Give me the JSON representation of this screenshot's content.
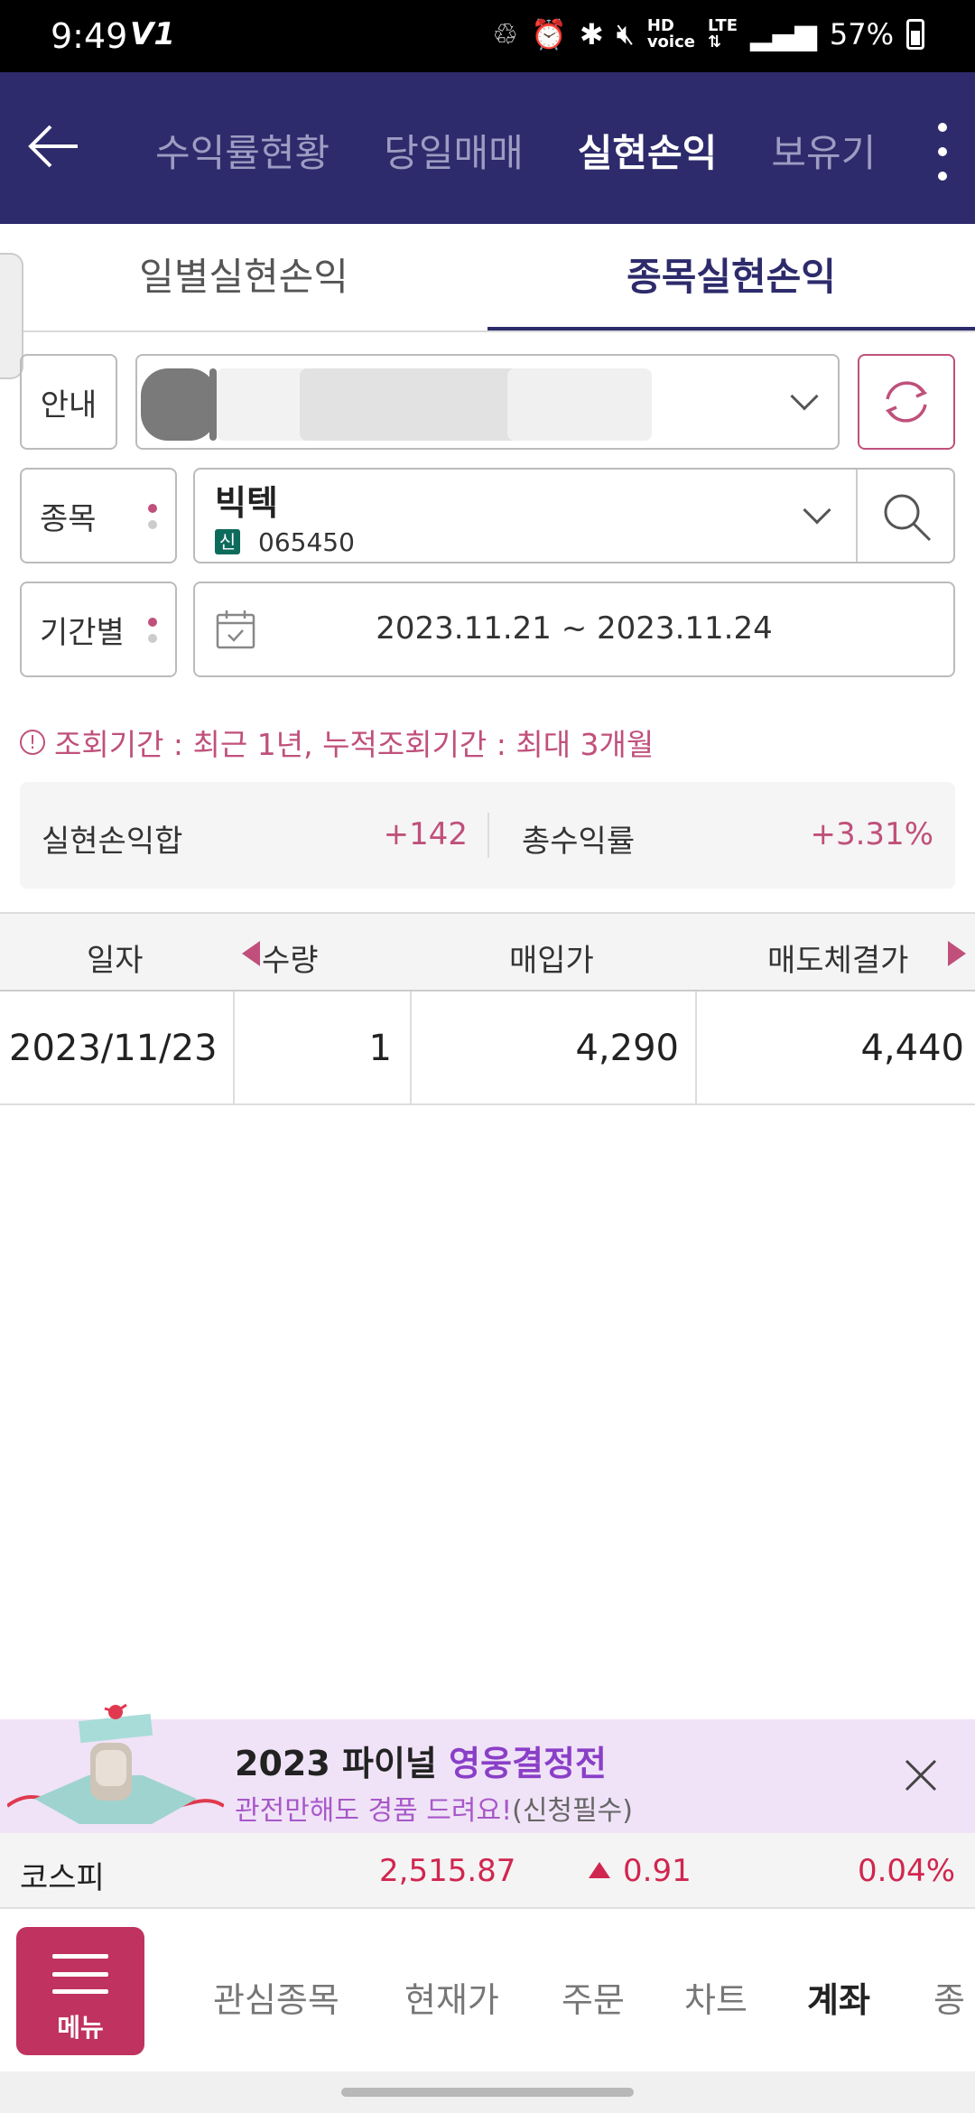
{
  "status_bar": {
    "time": "9:49",
    "carrier_icon": "V1",
    "battery": "57%",
    "icons": [
      "recycle-icon",
      "alarm-icon",
      "bluetooth-icon",
      "mute-icon",
      "hd-voice-icon",
      "lte-icon",
      "signal-icon",
      "battery-icon"
    ]
  },
  "top_nav": {
    "tabs": [
      {
        "label": "수익률현황",
        "active": false
      },
      {
        "label": "당일매매",
        "active": false
      },
      {
        "label": "실현손익",
        "active": true
      },
      {
        "label": "보유기",
        "active": false
      }
    ]
  },
  "sub_tabs": [
    {
      "label": "일별실현손익",
      "active": false
    },
    {
      "label": "종목실현손익",
      "active": true
    }
  ],
  "form": {
    "account_label": "안내",
    "stock_label": "종목",
    "period_label": "기간별",
    "stock_name": "빅텍",
    "market_badge": "신",
    "stock_code": "065450",
    "period": "2023.11.21 ~ 2023.11.24"
  },
  "notice": {
    "icon": "!",
    "text": "조회기간 : 최근 1년, 누적조회기간 : 최대 3개월"
  },
  "summary": {
    "realized_label": "실현손익합",
    "realized_value": "+142",
    "return_label": "총수익률",
    "return_value": "+3.31%"
  },
  "table": {
    "headers": [
      "일자",
      "수량",
      "매입가",
      "매도체결가"
    ],
    "rows": [
      {
        "date": "2023/11/23",
        "qty": "1",
        "buy_price": "4,290",
        "sell_price": "4,440"
      }
    ]
  },
  "banner": {
    "title_plain": "2023 파이널 ",
    "title_highlight": "영웅결정전",
    "sub_highlight": "관전만해도 경품 드려요!",
    "sub_plain": "(신청필수)"
  },
  "ticker": {
    "name": "코스피",
    "value": "2,515.87",
    "change": "0.91",
    "rate": "0.04%"
  },
  "bottom_nav": {
    "menu_label": "메뉴",
    "items": [
      {
        "label": "관심종목",
        "active": false
      },
      {
        "label": "현재가",
        "active": false
      },
      {
        "label": "주문",
        "active": false
      },
      {
        "label": "차트",
        "active": false
      },
      {
        "label": "계좌",
        "active": true
      },
      {
        "label": "종",
        "active": false
      }
    ]
  },
  "colors": {
    "nav_bg": "#2d2b6b",
    "accent": "#c0507b",
    "up_red": "#d0264f",
    "badge_green": "#0d6b5c",
    "banner_bg": "#f0e3f7"
  }
}
